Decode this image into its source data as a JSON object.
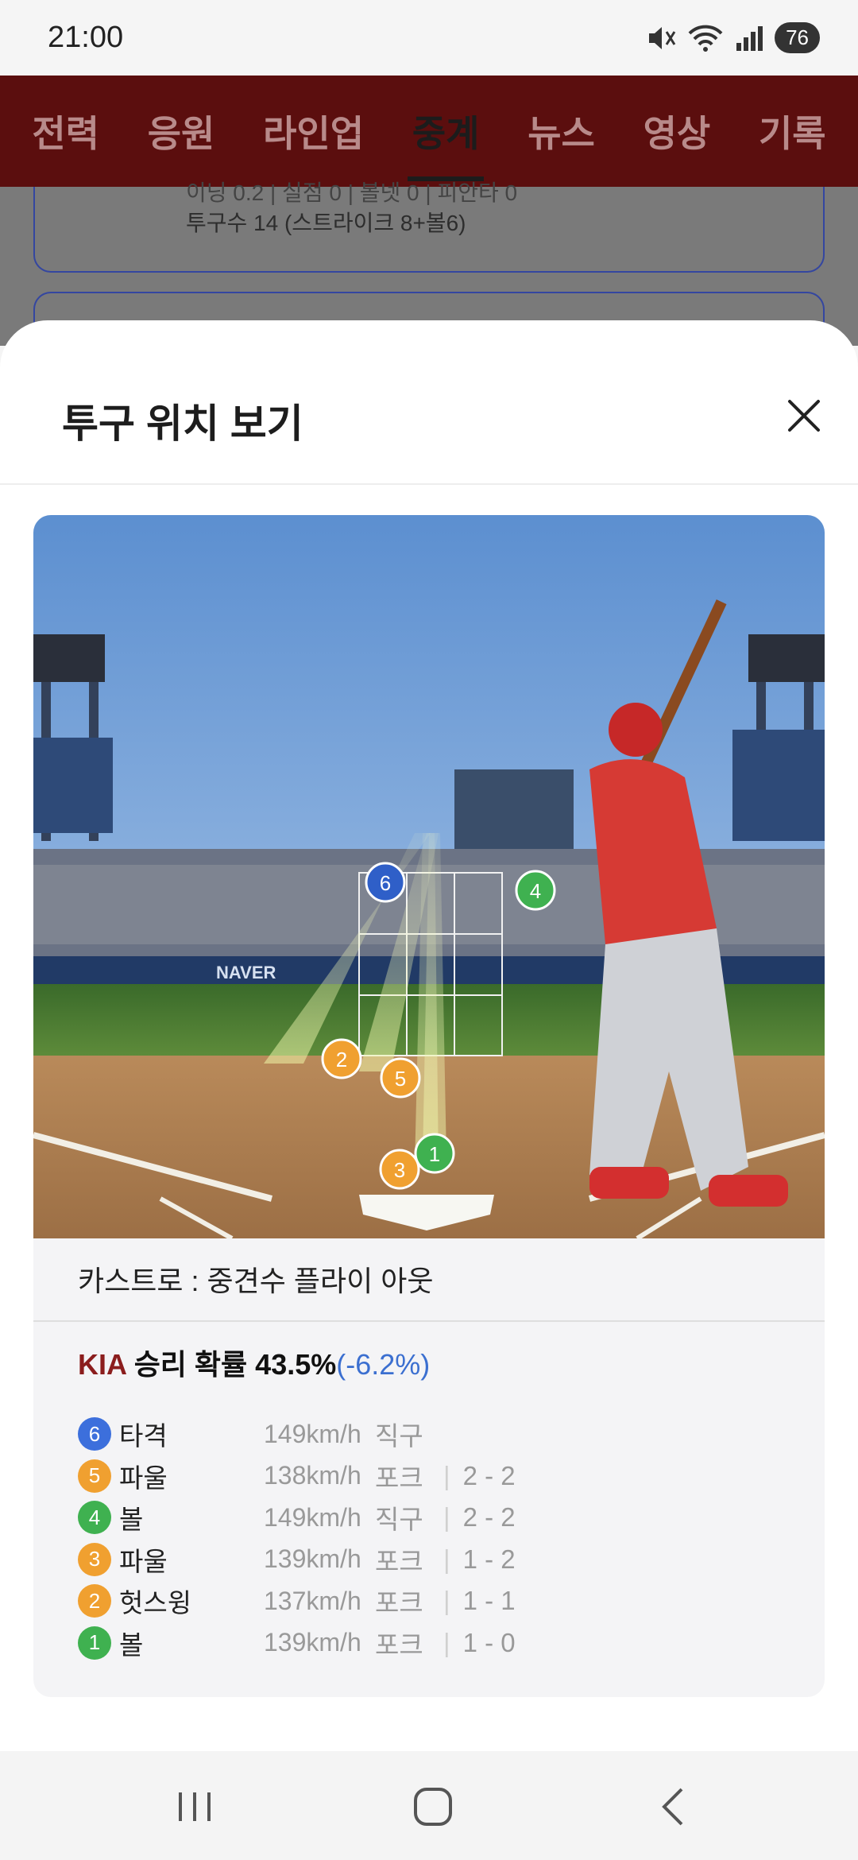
{
  "status_bar": {
    "time": "21:00",
    "battery": "76"
  },
  "tabs": [
    {
      "label": "전력"
    },
    {
      "label": "응원"
    },
    {
      "label": "라인업"
    },
    {
      "label": "중계"
    },
    {
      "label": "뉴스"
    },
    {
      "label": "영상"
    },
    {
      "label": "기록"
    }
  ],
  "active_tab": "중계",
  "background_card": {
    "line1": "이닝 0.2 | 실점 0 | 볼넷 0 | 피안타 0",
    "line2": "투구수 14 (스트라이크 8+볼6)"
  },
  "sheet": {
    "title": "투구 위치 보기",
    "result": "카스트로 : 중견수 플라이 아웃",
    "win_prob": {
      "team": "KIA",
      "label": "승리 확률 43.5%",
      "delta": "(-6.2%)"
    },
    "pitches": [
      {
        "num": "6",
        "color": "#3c6fdc",
        "result": "타격",
        "speed": "149km/h",
        "type": "직구",
        "count": ""
      },
      {
        "num": "5",
        "color": "#f0a030",
        "result": "파울",
        "speed": "138km/h",
        "type": "포크",
        "count": "2 - 2"
      },
      {
        "num": "4",
        "color": "#3fb150",
        "result": "볼",
        "speed": "149km/h",
        "type": "직구",
        "count": "2 - 2"
      },
      {
        "num": "3",
        "color": "#f0a030",
        "result": "파울",
        "speed": "139km/h",
        "type": "포크",
        "count": "1 - 2"
      },
      {
        "num": "2",
        "color": "#f0a030",
        "result": "헛스윙",
        "speed": "137km/h",
        "type": "포크",
        "count": "1 - 1"
      },
      {
        "num": "1",
        "color": "#3fb150",
        "result": "볼",
        "speed": "139km/h",
        "type": "포크",
        "count": "1 - 0"
      }
    ]
  },
  "scene": {
    "banner": "NAVER",
    "markers": [
      "1",
      "2",
      "3",
      "4",
      "5",
      "6"
    ]
  }
}
